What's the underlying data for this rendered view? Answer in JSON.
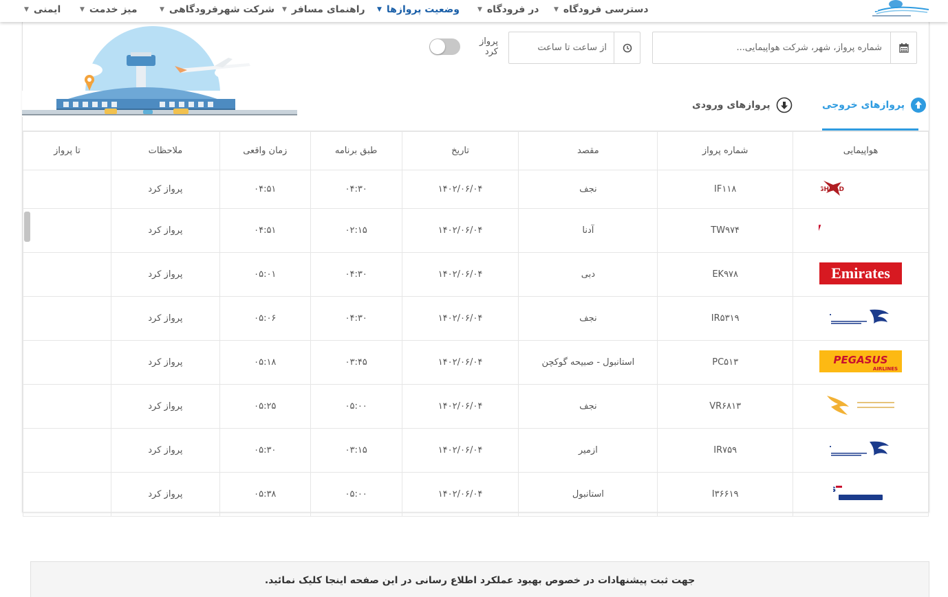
{
  "nav": {
    "items": [
      {
        "label": "دسترسی فرودگاه"
      },
      {
        "label": "در فرودگاه"
      },
      {
        "label": "وضعیت پروازها"
      },
      {
        "label": "راهنمای مسافر"
      },
      {
        "label": "شرکت شهرفرودگاهی"
      },
      {
        "label": "میز خدمت"
      },
      {
        "label": "ایمنی"
      }
    ],
    "active_index": 2
  },
  "filters": {
    "search_placeholder": "شماره پرواز، شهر، شرکت هواپیمایی...",
    "time_placeholder": "از ساعت تا ساعت",
    "toggle_label": "پرواز کرد",
    "toggle_on": false
  },
  "tabs": {
    "departures": "پروازهای خروجی",
    "arrivals": "پروازهای ورودی",
    "active": "departures"
  },
  "table": {
    "headers": {
      "airline": "هواپیمایی",
      "flight_no": "شماره پرواز",
      "destination": "مقصد",
      "date": "تاریخ",
      "scheduled": "طبق برنامه",
      "actual": "زمان واقعی",
      "notes": "ملاحظات",
      "gate": "تا پرواز"
    },
    "rows": [
      {
        "airline": "FLY BAGHDAD",
        "logo": "fly-baghdad",
        "flight_no": "IF۱۱۸",
        "destination": "نجف",
        "date": "۱۴۰۲/۰۶/۰۴",
        "scheduled": "۰۴:۳۰",
        "actual": "۰۴:۵۱",
        "notes": "پرواز کرد",
        "gate": ""
      },
      {
        "airline": "t'way",
        "logo": "tway",
        "flight_no": "TW۹۷۴",
        "destination": "آدنا",
        "date": "۱۴۰۲/۰۶/۰۴",
        "scheduled": "۰۲:۱۵",
        "actual": "۰۴:۵۱",
        "notes": "پرواز کرد",
        "gate": ""
      },
      {
        "airline": "Emirates",
        "logo": "emirates",
        "flight_no": "EK۹۷۸",
        "destination": "دبی",
        "date": "۱۴۰۲/۰۶/۰۴",
        "scheduled": "۰۴:۳۰",
        "actual": "۰۵:۰۱",
        "notes": "پرواز کرد",
        "gate": ""
      },
      {
        "airline": "IranAir",
        "logo": "iranair",
        "flight_no": "IR۵۳۱۹",
        "destination": "نجف",
        "date": "۱۴۰۲/۰۶/۰۴",
        "scheduled": "۰۴:۳۰",
        "actual": "۰۵:۰۶",
        "notes": "پرواز کرد",
        "gate": ""
      },
      {
        "airline": "PEGASUS",
        "logo": "pegasus",
        "flight_no": "PC۵۱۳",
        "destination": "استانبول - صبیحه گوکچن",
        "date": "۱۴۰۲/۰۶/۰۴",
        "scheduled": "۰۳:۴۵",
        "actual": "۰۵:۱۸",
        "notes": "پرواز کرد",
        "gate": ""
      },
      {
        "airline": "Varesh Airlines",
        "logo": "varesh",
        "flight_no": "VR۶۸۱۳",
        "destination": "نجف",
        "date": "۱۴۰۲/۰۶/۰۴",
        "scheduled": "۰۵:۰۰",
        "actual": "۰۵:۲۵",
        "notes": "پرواز کرد",
        "gate": ""
      },
      {
        "airline": "IranAir",
        "logo": "iranair",
        "flight_no": "IR۷۵۹",
        "destination": "ازمیر",
        "date": "۱۴۰۲/۰۶/۰۴",
        "scheduled": "۰۳:۱۵",
        "actual": "۰۵:۳۰",
        "notes": "پرواز کرد",
        "gate": ""
      },
      {
        "airline": "ATA Airlines",
        "logo": "ata",
        "flight_no": "I۳۶۶۱۹",
        "destination": "استانبول",
        "date": "۱۴۰۲/۰۶/۰۴",
        "scheduled": "۰۵:۰۰",
        "actual": "۰۵:۳۸",
        "notes": "پرواز کرد",
        "gate": ""
      }
    ]
  },
  "banner": {
    "text": "جهت ثبت پیشنهادات در خصوص بهبود عملکرد اطلاع رسانی در این صفحه اینجا کلیک نمائید."
  },
  "colors": {
    "accent": "#2e9be0",
    "nav_active": "#1a5fa8",
    "emirates": "#d71921",
    "tway": "#c8102e",
    "pegasus": "#fdb913",
    "iranair": "#1b3b8c"
  }
}
